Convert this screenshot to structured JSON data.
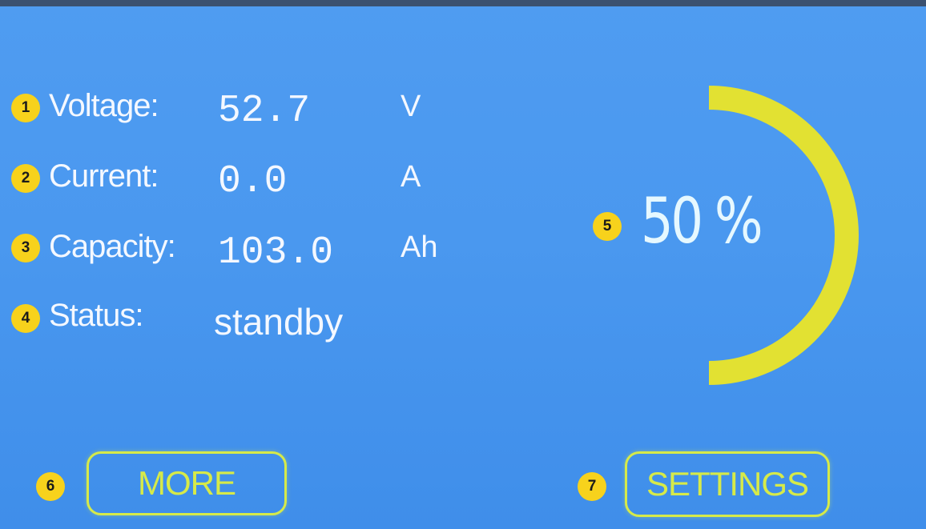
{
  "metrics": {
    "voltage": {
      "badge": "1",
      "label": "Voltage:",
      "value": "52.7",
      "unit": "V"
    },
    "current": {
      "badge": "2",
      "label": "Current:",
      "value": "0.0",
      "unit": "A"
    },
    "capacity": {
      "badge": "3",
      "label": "Capacity:",
      "value": "103.0",
      "unit": "Ah"
    },
    "status": {
      "badge": "4",
      "label": "Status:",
      "value": "standby"
    }
  },
  "gauge": {
    "badge": "5",
    "percent_text": "50 %",
    "level_fraction": 0.5,
    "color": "#e2e132"
  },
  "buttons": {
    "more": {
      "badge": "6",
      "label": "MORE"
    },
    "settings": {
      "badge": "7",
      "label": "SETTINGS"
    }
  },
  "colors": {
    "background": "#4a98ef",
    "badge": "#f7d21c",
    "button_outline": "#d6ea49",
    "text": "#f4f8ff"
  }
}
